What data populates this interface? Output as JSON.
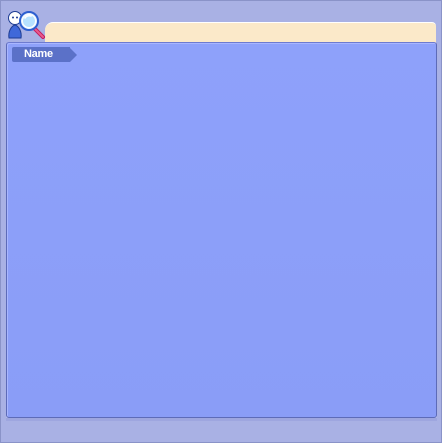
{
  "window": {
    "icon": "user-search-icon"
  },
  "list": {
    "columns": [
      {
        "label": "Name"
      }
    ],
    "rows": []
  },
  "colors": {
    "frame": "#a9b1e4",
    "header_tab": "#fbe9c9",
    "panel": "#8ea1fa",
    "column_header": "#5b71c8"
  }
}
